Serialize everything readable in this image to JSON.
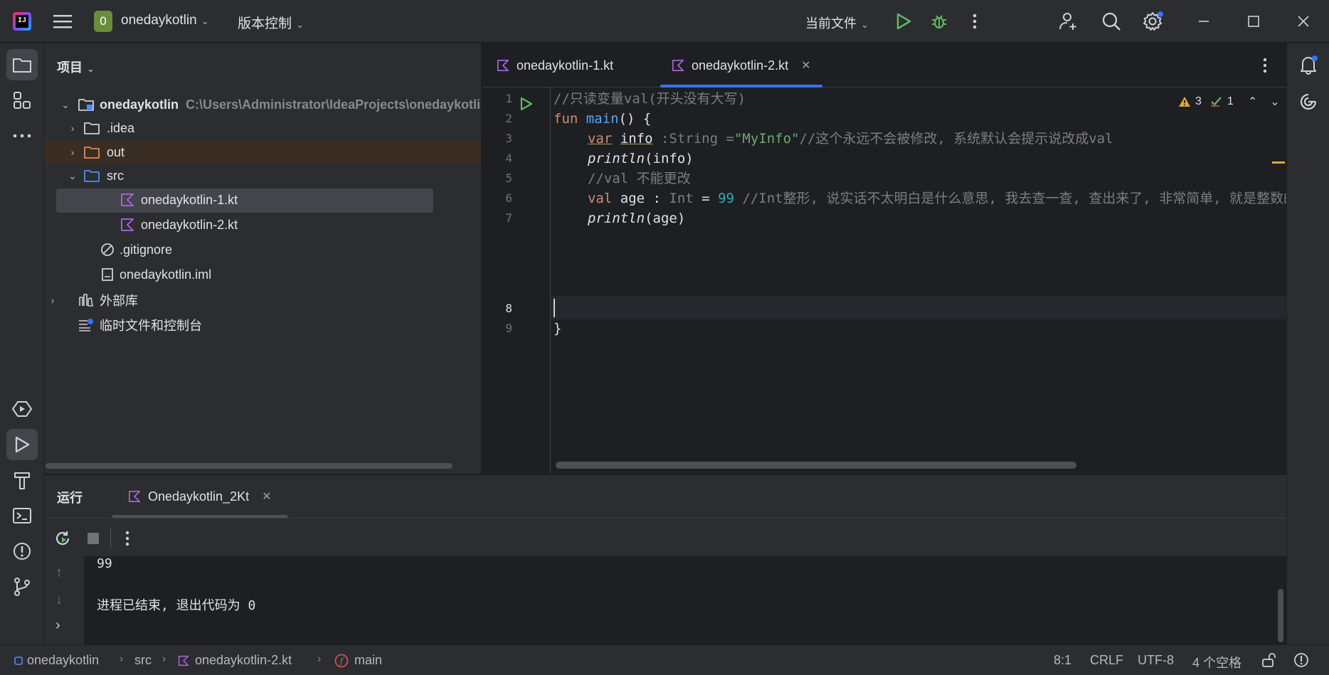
{
  "titlebar": {
    "project_badge": "0",
    "project_name": "onedaykotlin",
    "vcs_label": "版本控制",
    "run_config": "当前文件"
  },
  "project_panel": {
    "header": "项目",
    "root_name": "onedaykotlin",
    "root_path": "C:\\Users\\Administrator\\IdeaProjects\\onedaykotlin",
    "items": [
      {
        "label": ".idea"
      },
      {
        "label": "out"
      },
      {
        "label": "src"
      },
      {
        "label": "onedaykotlin-1.kt"
      },
      {
        "label": "onedaykotlin-2.kt"
      },
      {
        "label": ".gitignore"
      },
      {
        "label": "onedaykotlin.iml"
      },
      {
        "label": "外部库"
      },
      {
        "label": "临时文件和控制台"
      }
    ]
  },
  "editor": {
    "tabs": [
      {
        "label": "onedaykotlin-1.kt"
      },
      {
        "label": "onedaykotlin-2.kt",
        "active": true
      }
    ],
    "warnings_count": "3",
    "ok_count": "1",
    "line_numbers": [
      "1",
      "2",
      "3",
      "4",
      "5",
      "6",
      "7",
      "8",
      "9"
    ],
    "code": {
      "l1": "//只读变量val(开头没有大写)",
      "l2_kw": "fun",
      "l2_fn": "main",
      "l2_rest": "() {",
      "l3_kw": "var",
      "l3_name": "info",
      "l3_type": " :String =",
      "l3_str": "\"MyInfo\"",
      "l3_cm": "//这个永远不会被修改, 系统默认会提示说改成val",
      "l4_call": "println",
      "l4_arg": "(info)",
      "l5_cm": "//val 不能更改",
      "l6_kw": "val",
      "l6_name": " age : ",
      "l6_type": "Int",
      "l6_eq": " = ",
      "l6_num": "99",
      "l6_cm": " //Int整形, 说实话不太明白是什么意思, 我去查一查, 查出来了, 非常简单, 就是整数的",
      "l7_call": "println",
      "l7_arg": "(age)",
      "l9": "}"
    }
  },
  "run_panel": {
    "title": "运行",
    "tab_label": "Onedaykotlin_2Kt",
    "output": [
      "99",
      "进程已结束, 退出代码为 0"
    ]
  },
  "statusbar": {
    "crumbs": [
      "onedaykotlin",
      "src",
      "onedaykotlin-2.kt",
      "main"
    ],
    "position": "8:1",
    "line_ending": "CRLF",
    "encoding": "UTF-8",
    "indent": "4 个空格"
  },
  "colors": {
    "accent": "#3574f0",
    "kotlin_icon": "#b064e6",
    "run_green": "#5fb865",
    "warning": "#e0a838"
  }
}
